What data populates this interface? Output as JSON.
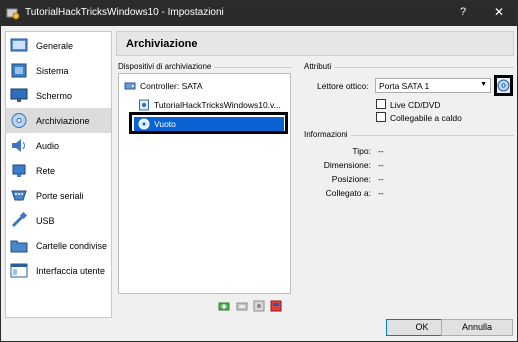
{
  "window": {
    "title": "TutorialHackTricksWindows10 - Impostazioni",
    "help_label": "?",
    "close_label": "✕"
  },
  "sidebar": {
    "items": [
      {
        "label": "Generale",
        "icon": "general-icon"
      },
      {
        "label": "Sistema",
        "icon": "system-icon"
      },
      {
        "label": "Schermo",
        "icon": "display-icon"
      },
      {
        "label": "Archiviazione",
        "icon": "storage-icon",
        "selected": true
      },
      {
        "label": "Audio",
        "icon": "audio-icon"
      },
      {
        "label": "Rete",
        "icon": "network-icon"
      },
      {
        "label": "Porte seriali",
        "icon": "serial-ports-icon"
      },
      {
        "label": "USB",
        "icon": "usb-icon"
      },
      {
        "label": "Cartelle condivise",
        "icon": "shared-folders-icon"
      },
      {
        "label": "Interfaccia utente",
        "icon": "user-interface-icon"
      }
    ]
  },
  "page": {
    "title": "Archiviazione"
  },
  "storage": {
    "group_label": "Dispositivi di archiviazione",
    "controller_label": "Controller: SATA",
    "disk_label": "TutorialHackTricksWindows10.v...",
    "optical_label": "Vuoto"
  },
  "attributes": {
    "group_label": "Attributi",
    "optical_drive_label": "Lettore ottico:",
    "optical_drive_value": "Porta SATA 1",
    "live_cd_label": "Live CD/DVD",
    "hotplug_label": "Collegabile a caldo"
  },
  "information": {
    "group_label": "Informazioni",
    "rows": [
      {
        "key": "Tipo:",
        "value": "--"
      },
      {
        "key": "Dimensione:",
        "value": "--"
      },
      {
        "key": "Posizione:",
        "value": "--"
      },
      {
        "key": "Collegato a:",
        "value": "--"
      }
    ]
  },
  "buttons": {
    "ok": "OK",
    "cancel": "Annulla"
  },
  "colors": {
    "titlebar": "#2b2b2b",
    "selection": "#0a63d3",
    "highlight_border": "#000000"
  }
}
